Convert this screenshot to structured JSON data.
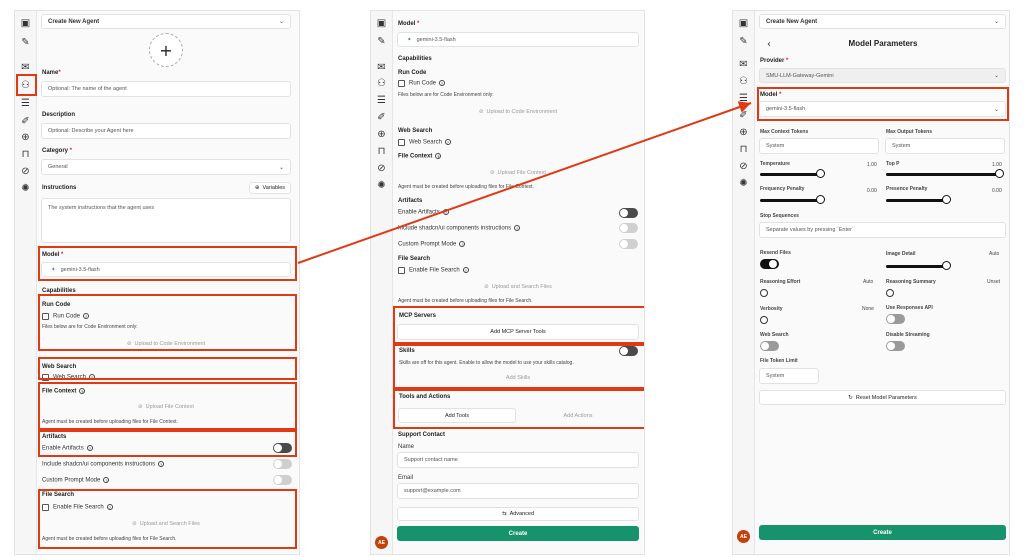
{
  "p1": {
    "title": "Create New Agent",
    "name_label": "Name",
    "name_placeholder": "Optional: The name of the agent",
    "desc_label": "Description",
    "desc_placeholder": "Optional: Describe your Agent here",
    "category_label": "Category",
    "category_value": "General",
    "instructions_label": "Instructions",
    "variables_label": "Variables",
    "instructions_placeholder": "The system instructions that the agent uses",
    "model_label": "Model",
    "model_value": "gemini-3.5-flash",
    "capabilities": "Capabilities",
    "run_code_title": "Run Code",
    "run_code": "Run Code",
    "files_note": "Files below are for Code Environment only:",
    "upload_code_env": "Upload to Code Environment",
    "web_search_title": "Web Search",
    "web_search": "Web Search",
    "file_context": "File Context",
    "upload_file_context": "Upload File Context",
    "file_context_note": "Agent must be created before uploading files for File Context.",
    "artifacts": "Artifacts",
    "enable_artifacts": "Enable Artifacts",
    "shadcn": "Include shadcn/ui components instructions",
    "custom_prompt": "Custom Prompt Mode",
    "file_search_title": "File Search",
    "enable_file_search": "Enable File Search",
    "upload_search": "Upload and Search Files",
    "file_search_note": "Agent must be created before uploading files for File Search."
  },
  "p2": {
    "model_label": "Model",
    "model_value": "gemini-3.5-flash",
    "capabilities": "Capabilities",
    "run_code_title": "Run Code",
    "run_code": "Run Code",
    "files_note": "Files below are for Code Environment only:",
    "upload_code_env": "Upload to Code Environment",
    "web_search_title": "Web Search",
    "web_search": "Web Search",
    "file_context": "File Context",
    "upload_file_context": "Upload File Context",
    "file_context_note": "Agent must be created before uploading files for File Context.",
    "artifacts": "Artifacts",
    "enable_artifacts": "Enable Artifacts",
    "shadcn": "Include shadcn/ui components instructions",
    "custom_prompt": "Custom Prompt Mode",
    "file_search_title": "File Search",
    "enable_file_search": "Enable File Search",
    "upload_search": "Upload and Search Files",
    "file_search_note": "Agent must be created before uploading files for File Search.",
    "mcp_servers": "MCP Servers",
    "add_mcp": "Add MCP Server Tools",
    "skills": "Skills",
    "skills_note": "Skills are off for this agent. Enable to allow the model to use your skills catalog.",
    "add_skills": "Add Skills",
    "tools_actions": "Tools and Actions",
    "add_tools": "Add Tools",
    "add_actions": "Add Actions",
    "support_contact": "Support Contact",
    "support_name_label": "Name",
    "support_name_placeholder": "Support contact name",
    "support_email_label": "Email",
    "support_email_placeholder": "support@example.com",
    "advanced": "Advanced",
    "create": "Create"
  },
  "p3": {
    "title": "Create New Agent",
    "heading": "Model Parameters",
    "provider_label": "Provider",
    "provider_value": "SMU-LLM-Gateway-Gemini",
    "model_label": "Model",
    "model_value": "gemini-3.5-flash",
    "max_context": "Max Context Tokens",
    "max_context_ph": "System",
    "max_output": "Max Output Tokens",
    "max_output_ph": "System",
    "temperature": "Temperature",
    "temperature_val": "1.00",
    "top_p": "Top P",
    "top_p_val": "1.00",
    "freq_penalty": "Frequency Penalty",
    "freq_val": "0.00",
    "pres_penalty": "Presence Penalty",
    "pres_val": "0.00",
    "stop_seq": "Stop Sequences",
    "stop_seq_ph": "Separate values by pressing `Enter`",
    "resend_files": "Resend Files",
    "image_detail": "Image Detail",
    "image_detail_val": "Auto",
    "reasoning_effort": "Reasoning Effort",
    "reasoning_effort_val": "Auto",
    "reasoning_summary": "Reasoning Summary",
    "reasoning_summary_val": "Unset",
    "verbosity": "Verbosity",
    "verbosity_val": "None",
    "use_responses": "Use Responses API",
    "web_search": "Web Search",
    "disable_streaming": "Disable Streaming",
    "file_token_limit": "File Token Limit",
    "file_token_ph": "System",
    "reset": "Reset Model Parameters",
    "create": "Create"
  },
  "avatar_initials": "AE",
  "icons": [
    "sidebar-toggle-icon",
    "new-chat-icon",
    "chats-icon",
    "agent-builder-icon",
    "prompts-icon",
    "memories-icon",
    "mcp-icon",
    "bookmarks-icon",
    "attach-files-icon",
    "settings-icon"
  ],
  "accent_color": "#16936a",
  "highlight_color": "#e03a15"
}
